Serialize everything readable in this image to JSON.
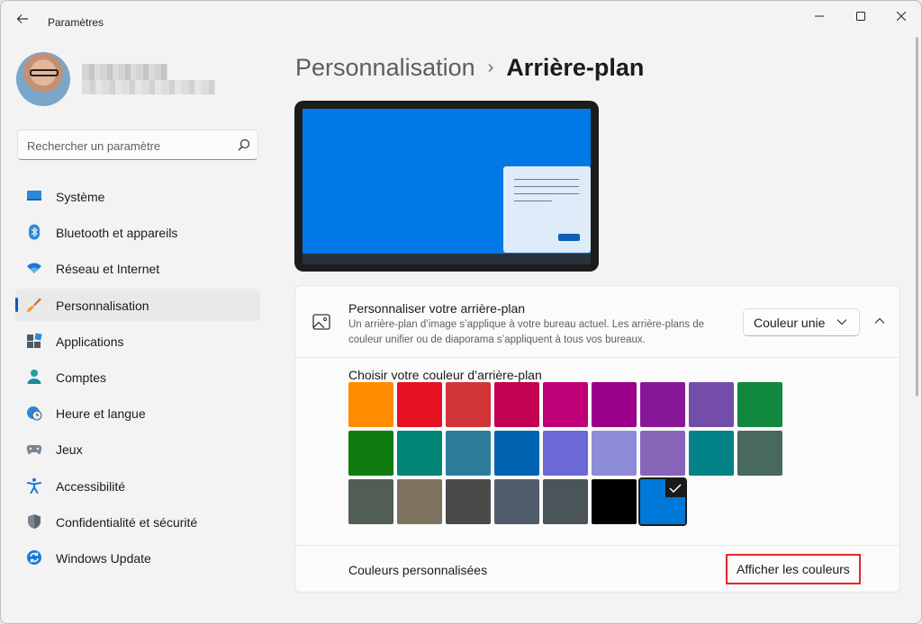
{
  "window": {
    "title": "Paramètres",
    "controls": {
      "minimize_icon": "minimize-icon",
      "maximize_icon": "maximize-icon",
      "close_icon": "close-icon"
    }
  },
  "profile": {
    "name_blurred": true,
    "email_blurred": true
  },
  "search": {
    "placeholder": "Rechercher un paramètre",
    "value": "",
    "icon": "search-icon"
  },
  "sidebar": {
    "items": [
      {
        "label": "Système",
        "icon": "monitor-icon",
        "active": false
      },
      {
        "label": "Bluetooth et appareils",
        "icon": "bluetooth-icon",
        "active": false
      },
      {
        "label": "Réseau et Internet",
        "icon": "wifi-icon",
        "active": false
      },
      {
        "label": "Personnalisation",
        "icon": "brush-icon",
        "active": true
      },
      {
        "label": "Applications",
        "icon": "apps-icon",
        "active": false
      },
      {
        "label": "Comptes",
        "icon": "person-icon",
        "active": false
      },
      {
        "label": "Heure et langue",
        "icon": "globe-clock-icon",
        "active": false
      },
      {
        "label": "Jeux",
        "icon": "gamepad-icon",
        "active": false
      },
      {
        "label": "Accessibilité",
        "icon": "accessibility-icon",
        "active": false
      },
      {
        "label": "Confidentialité et sécurité",
        "icon": "shield-icon",
        "active": false
      },
      {
        "label": "Windows Update",
        "icon": "update-icon",
        "active": false
      }
    ]
  },
  "breadcrumb": {
    "parent": "Personnalisation",
    "separator": "›",
    "current": "Arrière-plan"
  },
  "background_card": {
    "title": "Personnaliser votre arrière-plan",
    "description": "Un arrière-plan d’image s’applique à votre bureau actuel. Les arrière-plans de couleur unifier ou de diaporama s’appliquent à tous vos bureaux.",
    "dropdown_value": "Couleur unie",
    "colors_label": "Choisir votre couleur d’arrière-plan",
    "swatches": [
      "#ff8c00",
      "#e81123",
      "#d13438",
      "#c30052",
      "#bf0077",
      "#9a0089",
      "#881798",
      "#744da9",
      "#10893e",
      "#107c10",
      "#018574",
      "#2d7d9a",
      "#0063b1",
      "#6b69d6",
      "#8e8cd8",
      "#8764b8",
      "#038387",
      "#486860",
      "#525e54",
      "#7e735f",
      "#4c4a48",
      "#515c6b",
      "#4a5459",
      "#000000",
      "#0078d7"
    ],
    "selected_index": 24,
    "custom_colors_label": "Couleurs personnalisées",
    "show_colors_button": "Afficher les couleurs"
  },
  "colors": {
    "accent": "#005fb8",
    "highlight_box": "#e4262b",
    "preview_wallpaper": "#0078e6"
  }
}
